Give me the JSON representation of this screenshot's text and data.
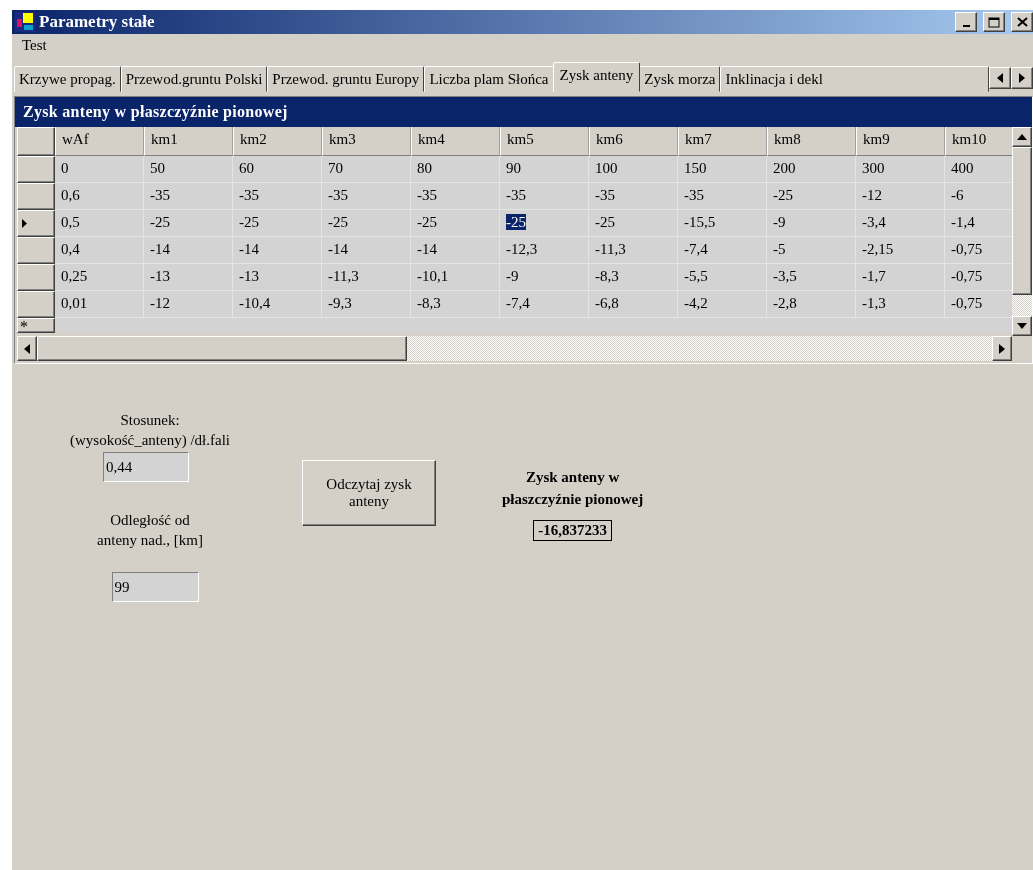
{
  "window": {
    "title": "Parametry stałe"
  },
  "menu": [
    "Test"
  ],
  "tabs": [
    {
      "label": "Krzywe propag.",
      "selected": false
    },
    {
      "label": "Przewod.gruntu Polski",
      "selected": false
    },
    {
      "label": "Przewod. gruntu Europy",
      "selected": false
    },
    {
      "label": "Liczba plam Słońca",
      "selected": false
    },
    {
      "label": "Zysk anteny",
      "selected": true
    },
    {
      "label": "Zysk morza",
      "selected": false
    },
    {
      "label": "Inklinacja i dekl",
      "selected": false
    }
  ],
  "grid": {
    "caption": "Zysk anteny w płaszczyźnie pionowej",
    "columns": [
      "wAf",
      "km1",
      "km2",
      "km3",
      "km4",
      "km5",
      "km6",
      "km7",
      "km8",
      "km9",
      "km10"
    ],
    "rows": [
      {
        "current": false,
        "cells": [
          {
            "text": "0",
            "selected": false
          },
          {
            "text": "50",
            "selected": false
          },
          {
            "text": "60",
            "selected": false
          },
          {
            "text": "70",
            "selected": false
          },
          {
            "text": "80",
            "selected": false
          },
          {
            "text": "90",
            "selected": false
          },
          {
            "text": "100",
            "selected": false
          },
          {
            "text": "150",
            "selected": false
          },
          {
            "text": "200",
            "selected": false
          },
          {
            "text": "300",
            "selected": false
          },
          {
            "text": "400",
            "selected": false
          }
        ]
      },
      {
        "current": false,
        "cells": [
          {
            "text": "0,6",
            "selected": false
          },
          {
            "text": "-35",
            "selected": false
          },
          {
            "text": "-35",
            "selected": false
          },
          {
            "text": "-35",
            "selected": false
          },
          {
            "text": "-35",
            "selected": false
          },
          {
            "text": "-35",
            "selected": false
          },
          {
            "text": "-35",
            "selected": false
          },
          {
            "text": "-35",
            "selected": false
          },
          {
            "text": "-25",
            "selected": false
          },
          {
            "text": "-12",
            "selected": false
          },
          {
            "text": "-6",
            "selected": false
          }
        ]
      },
      {
        "current": true,
        "cells": [
          {
            "text": "0,5",
            "selected": false
          },
          {
            "text": "-25",
            "selected": false
          },
          {
            "text": "-25",
            "selected": false
          },
          {
            "text": "-25",
            "selected": false
          },
          {
            "text": "-25",
            "selected": false
          },
          {
            "text": "-25",
            "selected": true
          },
          {
            "text": "-25",
            "selected": false
          },
          {
            "text": "-15,5",
            "selected": false
          },
          {
            "text": "-9",
            "selected": false
          },
          {
            "text": "-3,4",
            "selected": false
          },
          {
            "text": "-1,4",
            "selected": false
          }
        ]
      },
      {
        "current": false,
        "cells": [
          {
            "text": "0,4",
            "selected": false
          },
          {
            "text": "-14",
            "selected": false
          },
          {
            "text": "-14",
            "selected": false
          },
          {
            "text": "-14",
            "selected": false
          },
          {
            "text": "-14",
            "selected": false
          },
          {
            "text": "-12,3",
            "selected": false
          },
          {
            "text": "-11,3",
            "selected": false
          },
          {
            "text": "-7,4",
            "selected": false
          },
          {
            "text": "-5",
            "selected": false
          },
          {
            "text": "-2,15",
            "selected": false
          },
          {
            "text": "-0,75",
            "selected": false
          }
        ]
      },
      {
        "current": false,
        "cells": [
          {
            "text": "0,25",
            "selected": false
          },
          {
            "text": "-13",
            "selected": false
          },
          {
            "text": "-13",
            "selected": false
          },
          {
            "text": "-11,3",
            "selected": false
          },
          {
            "text": "-10,1",
            "selected": false
          },
          {
            "text": "-9",
            "selected": false
          },
          {
            "text": "-8,3",
            "selected": false
          },
          {
            "text": "-5,5",
            "selected": false
          },
          {
            "text": "-3,5",
            "selected": false
          },
          {
            "text": "-1,7",
            "selected": false
          },
          {
            "text": "-0,75",
            "selected": false
          }
        ]
      },
      {
        "current": false,
        "cells": [
          {
            "text": "0,01",
            "selected": false
          },
          {
            "text": "-12",
            "selected": false
          },
          {
            "text": "-10,4",
            "selected": false
          },
          {
            "text": "-9,3",
            "selected": false
          },
          {
            "text": "-8,3",
            "selected": false
          },
          {
            "text": "-7,4",
            "selected": false
          },
          {
            "text": "-6,8",
            "selected": false
          },
          {
            "text": "-4,2",
            "selected": false
          },
          {
            "text": "-2,8",
            "selected": false
          },
          {
            "text": "-1,3",
            "selected": false
          },
          {
            "text": "-0,75",
            "selected": false
          }
        ]
      }
    ],
    "new_row_marker": "*"
  },
  "form": {
    "ratio_label": "Stosunek:\n(wysokość_anteny) /dł.fali",
    "ratio_value": "0,44",
    "distance_label": "Odległość od\nanteny nad., [km]",
    "distance_value": "99",
    "read_button": "Odczytaj zysk\nanteny",
    "result_label": "Zysk anteny w\npłaszczyźnie pionowej",
    "result_value": "-16,837233"
  }
}
